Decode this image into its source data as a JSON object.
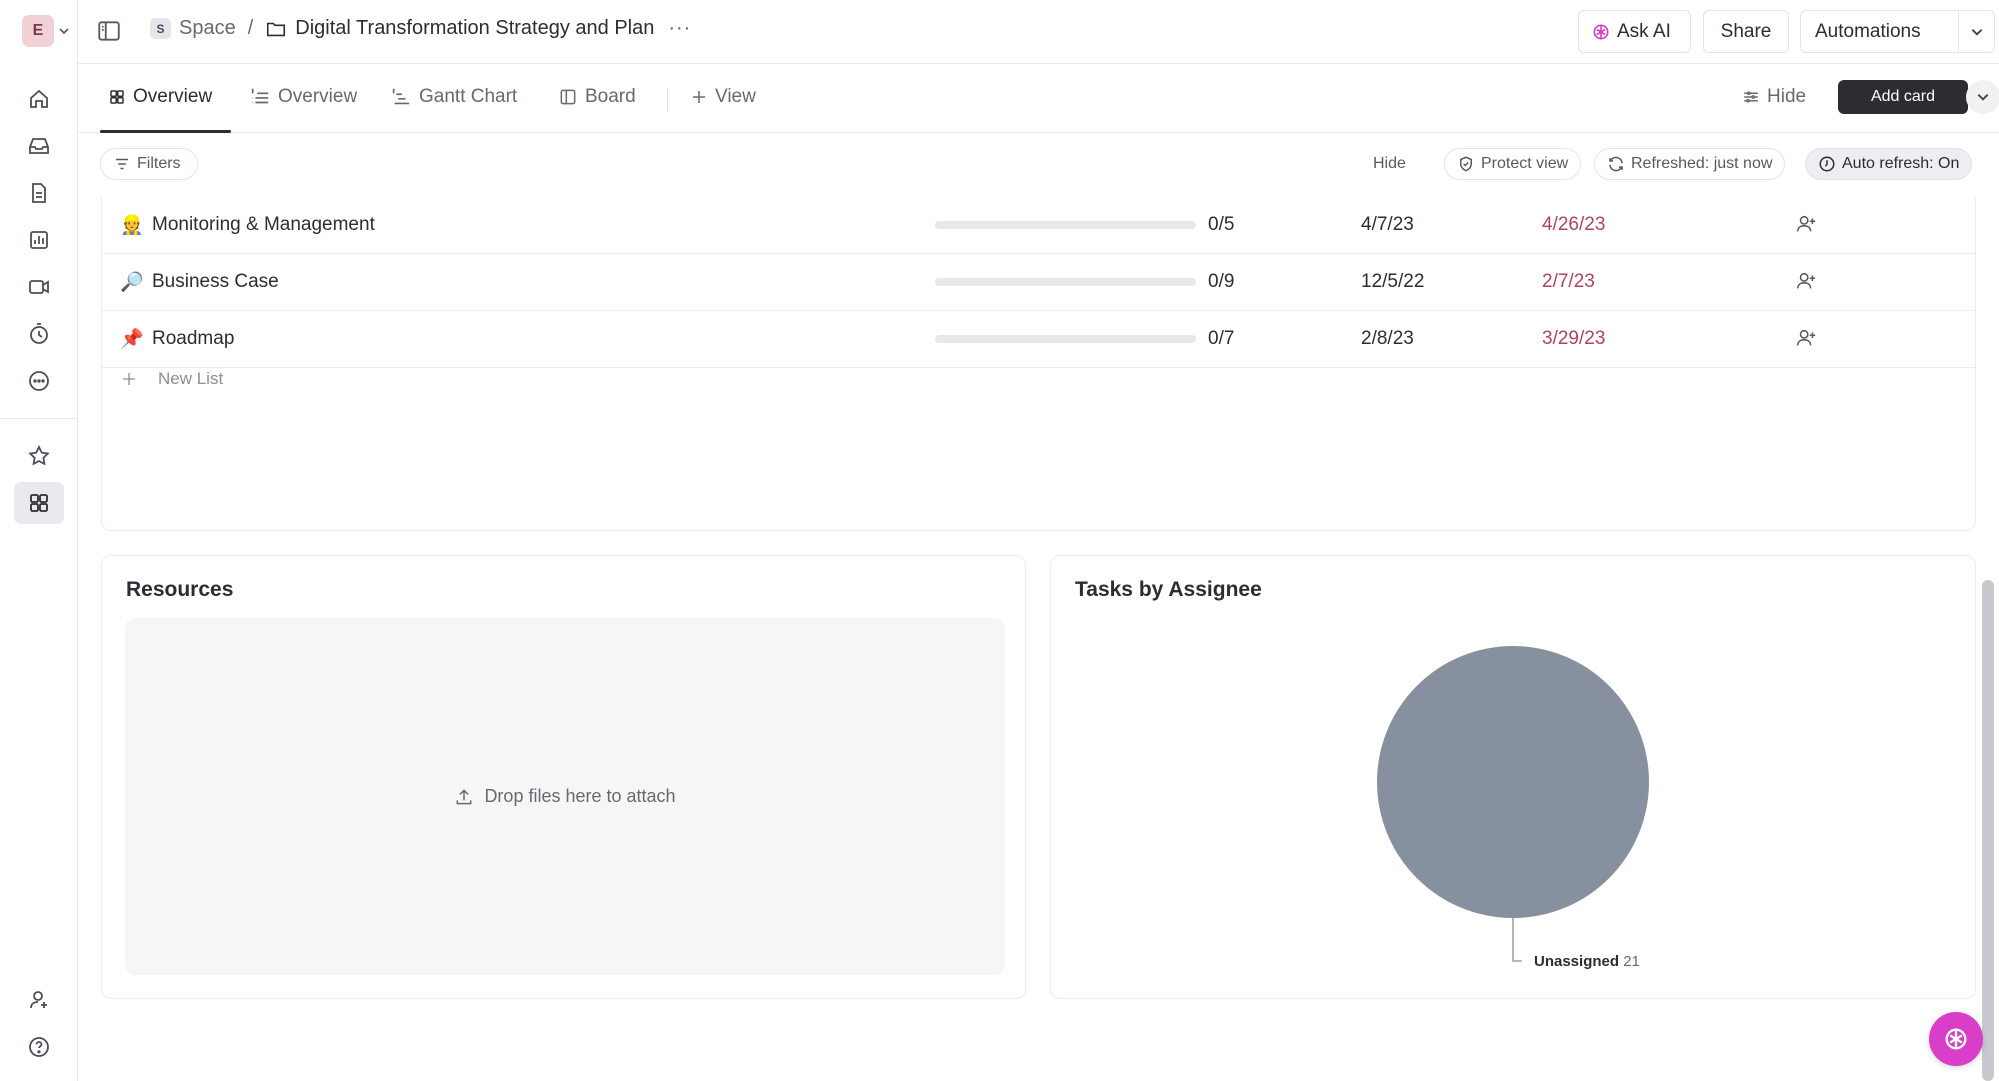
{
  "workspace": {
    "initial": "E"
  },
  "breadcrumb": {
    "space_badge": "S",
    "space": "Space",
    "separator": "/",
    "folder": "Digital Transformation Strategy and Plan",
    "more": "···"
  },
  "header": {
    "ask_ai": "Ask AI",
    "share": "Share",
    "automations": "Automations"
  },
  "tabs": [
    {
      "label": "Overview",
      "icon": "grid-icon",
      "active": true
    },
    {
      "label": "Overview",
      "icon": "list-icon",
      "active": false
    },
    {
      "label": "Gantt Chart",
      "icon": "gantt-icon",
      "active": false
    },
    {
      "label": "Board",
      "icon": "board-icon",
      "active": false
    }
  ],
  "tabs_extra": {
    "add_view": "View",
    "hide": "Hide",
    "add_card": "Add card"
  },
  "filterbar": {
    "filters": "Filters",
    "hide": "Hide",
    "protect": "Protect view",
    "refreshed": "Refreshed: just now",
    "auto_refresh": "Auto refresh: On"
  },
  "lists": [
    {
      "emoji": "👷",
      "name": "Monitoring & Management",
      "progress": "0/5",
      "progress_fraction": 0,
      "start": "4/7/23",
      "due": "4/26/23"
    },
    {
      "emoji": "🔎",
      "name": "Business Case",
      "progress": "0/9",
      "progress_fraction": 0,
      "start": "12/5/22",
      "due": "2/7/23"
    },
    {
      "emoji": "📌",
      "name": "Roadmap",
      "progress": "0/7",
      "progress_fraction": 0,
      "start": "2/8/23",
      "due": "3/29/23"
    }
  ],
  "new_list": "New List",
  "resources": {
    "title": "Resources",
    "dropzone": "Drop files here to attach"
  },
  "tasks_by_assignee": {
    "title": "Tasks by Assignee"
  },
  "chart_data": {
    "type": "pie",
    "title": "Tasks by Assignee",
    "slices": [
      {
        "label": "Unassigned",
        "value": 21,
        "color": "#87909e"
      }
    ]
  },
  "colors": {
    "due_overdue": "#b0445a",
    "accent_ai": "#d83ec8",
    "add_card_bg": "#2b2d31"
  }
}
